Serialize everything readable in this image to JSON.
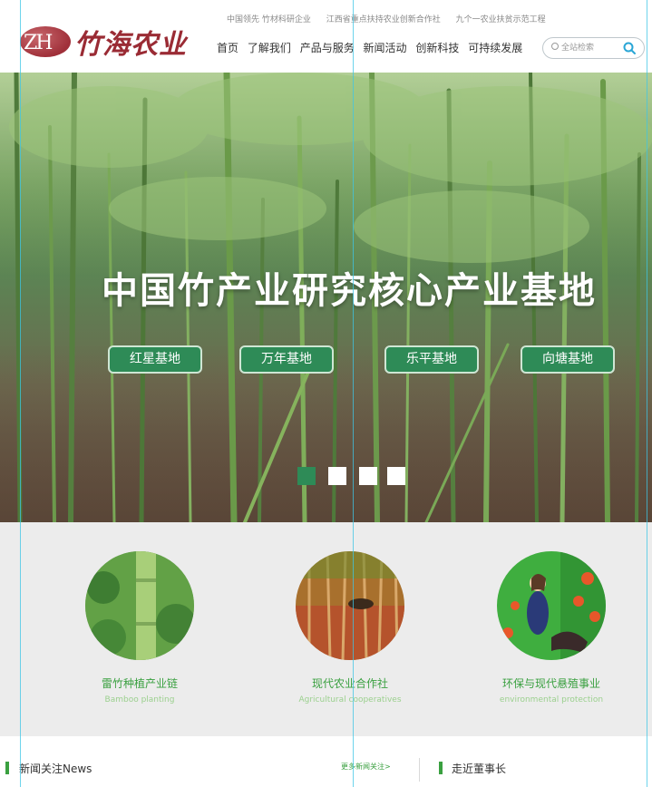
{
  "brand": {
    "badge": "ZH",
    "name": "竹海农业",
    "color": "#9a2b34"
  },
  "top_links": [
    "中国领先 竹材科研企业",
    "江西省重点扶持农业创新合作社",
    "九个一农业扶贫示范工程"
  ],
  "nav": [
    "首页",
    "了解我们",
    "产品与服务",
    "新闻活动",
    "创新科技",
    "可持续发展"
  ],
  "search": {
    "placeholder": "全站检索",
    "icon": "search-icon"
  },
  "hero": {
    "title": "中国竹产业研究核心产业基地",
    "bases": [
      "红星基地",
      "万年基地",
      "乐平基地",
      "向塘基地"
    ],
    "slides": 4,
    "active_slide": 1,
    "accent": "#2e8b57"
  },
  "features": [
    {
      "title": "雷竹种植产业链",
      "subtitle": "Bamboo planting"
    },
    {
      "title": "现代农业合作社",
      "subtitle": "Agricultural cooperatives"
    },
    {
      "title": "环保与现代悬殖事业",
      "subtitle": "environmental protection"
    }
  ],
  "bottom": {
    "news_title": "新闻关注News",
    "more_link": "更多新闻关注>",
    "chairman_title": "走近董事长"
  }
}
